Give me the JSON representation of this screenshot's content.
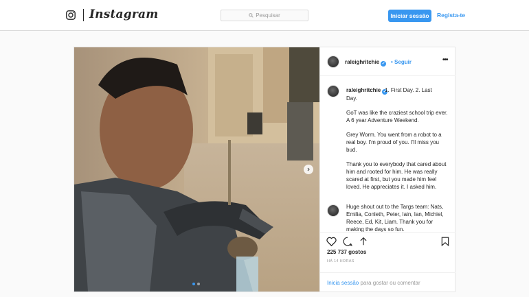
{
  "header": {
    "brand": "Instagram",
    "search_placeholder": "Pesquisar",
    "login_button": "Iniciar sessão",
    "signup_link": "Regista-te"
  },
  "post": {
    "username": "raleighritchie",
    "verified": true,
    "follow_separator": "•",
    "follow_label": "Seguir",
    "more_label": "•••",
    "caption_first_line": "1. First Day. 2. Last",
    "caption_paragraphs": [
      "Day.",
      "GoT was like the craziest school trip ever. A 6 year Adventure Weekend.",
      "Grey Worm. You went from a robot to a real boy. I'm proud of you. I'll miss you bud.",
      "Thank you to everybody that cared about him and rooted for him. He was really scared at first, but you made him feel loved. He appreciates it. I asked him."
    ],
    "second_comment": "Huge shout out to the Targs team: Nats, Emilia, Conleth, Peter, Iain, Ian, Michiel, Reece, Ed, Kit, Liam. Thank you for making the days so fun.",
    "likes": "225 737 gostos",
    "timestamp": "HÁ 14 HORAS",
    "carousel": {
      "slides": 2,
      "active_index": 0
    },
    "login_prompt": {
      "link": "Inicia sessão",
      "text": " para gostar ou comentar"
    }
  },
  "colors": {
    "accent": "#3897f0",
    "border": "#dbdbdb",
    "background": "#fafafa"
  },
  "icons": [
    "instagram-camera-icon",
    "search-icon",
    "verified-badge-icon",
    "heart-icon",
    "comment-icon",
    "share-icon",
    "bookmark-icon",
    "chevron-right-icon"
  ]
}
